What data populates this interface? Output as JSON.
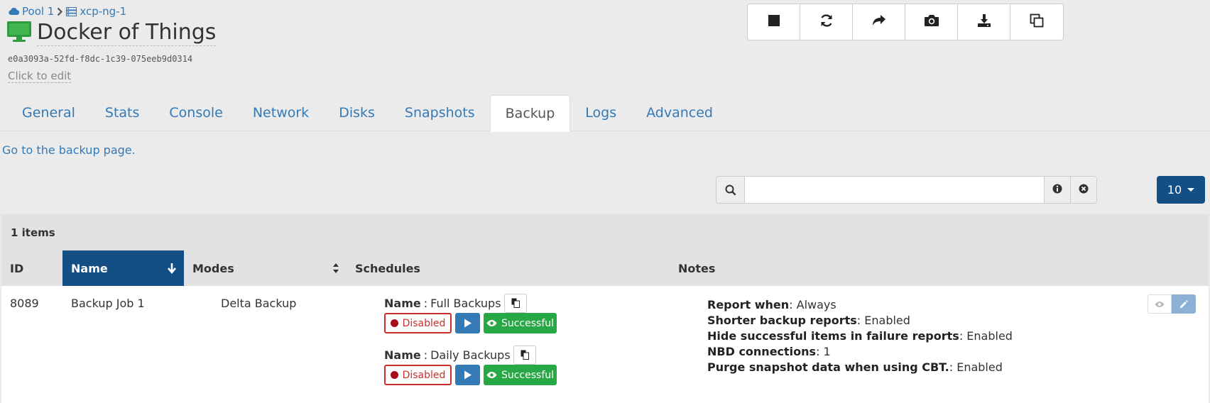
{
  "breadcrumb": {
    "pool": "Pool 1",
    "host": "xcp-ng-1"
  },
  "vm": {
    "title": "Docker of Things",
    "uuid": "e0a3093a-52fd-f8dc-1c39-075eeb9d0314",
    "edit_hint": "Click to edit"
  },
  "toolbar": {
    "icons": [
      "stop-icon",
      "refresh-icon",
      "share-icon",
      "camera-icon",
      "download-icon",
      "copy-icon"
    ]
  },
  "tabs": [
    {
      "label": "General"
    },
    {
      "label": "Stats"
    },
    {
      "label": "Console"
    },
    {
      "label": "Network"
    },
    {
      "label": "Disks"
    },
    {
      "label": "Snapshots"
    },
    {
      "label": "Backup",
      "active": true
    },
    {
      "label": "Logs"
    },
    {
      "label": "Advanced"
    }
  ],
  "backup_link": "Go to the backup page.",
  "filter": {
    "value": "",
    "placeholder": ""
  },
  "page_size": "10",
  "table": {
    "item_count": "1 items",
    "columns": [
      "ID",
      "Name",
      "Modes",
      "Schedules",
      "Notes"
    ],
    "sorted_column": "Name",
    "rows": [
      {
        "id": "8089",
        "name": "Backup Job 1",
        "mode": "Delta Backup",
        "schedules": [
          {
            "name_label": "Name",
            "name": "Full Backups",
            "state": "Disabled",
            "last_run": "Successful"
          },
          {
            "name_label": "Name",
            "name": "Daily Backups",
            "state": "Disabled",
            "last_run": "Successful"
          }
        ],
        "notes": [
          {
            "key": "Report when",
            "value": ": Always"
          },
          {
            "key": "Shorter backup reports",
            "value": ": Enabled"
          },
          {
            "key": "Hide successful items in failure reports",
            "value": ": Enabled"
          },
          {
            "key": "NBD connections",
            "value": ": 1"
          },
          {
            "key": "Purge snapshot data when using CBT.",
            "value": ": Enabled"
          }
        ]
      }
    ]
  },
  "colors": {
    "link": "#337ab7",
    "primary_dark": "#134e85",
    "success": "#28a745",
    "danger": "#c9302c",
    "vm_icon": "#2e9c3e"
  }
}
